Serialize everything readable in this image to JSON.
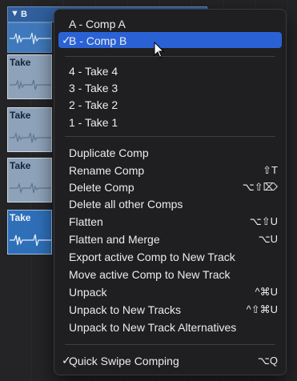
{
  "background": {
    "folder_label": "B",
    "take_labels": [
      "Take",
      "Take",
      "Take",
      "Take"
    ]
  },
  "menu": {
    "comps": [
      {
        "label": "A - Comp A",
        "checked": false,
        "selected": false
      },
      {
        "label": "B - Comp B",
        "checked": true,
        "selected": true
      }
    ],
    "takes": [
      {
        "label": "4 - Take 4"
      },
      {
        "label": "3 - Take 3"
      },
      {
        "label": "2 - Take 2"
      },
      {
        "label": "1 - Take 1"
      }
    ],
    "actions": [
      {
        "label": "Duplicate Comp",
        "shortcut": ""
      },
      {
        "label": "Rename Comp",
        "shortcut": "⇧T"
      },
      {
        "label": "Delete Comp",
        "shortcut": "⌥⇧⌦"
      },
      {
        "label": "Delete all other Comps",
        "shortcut": ""
      },
      {
        "label": "Flatten",
        "shortcut": "⌥⇧U"
      },
      {
        "label": "Flatten and Merge",
        "shortcut": "⌥U"
      },
      {
        "label": "Export active Comp to New Track",
        "shortcut": ""
      },
      {
        "label": "Move active Comp to New Track",
        "shortcut": ""
      },
      {
        "label": "Unpack",
        "shortcut": "^⌘U"
      },
      {
        "label": "Unpack to New Tracks",
        "shortcut": "^⇧⌘U"
      },
      {
        "label": "Unpack to New Track Alternatives",
        "shortcut": ""
      }
    ],
    "quick_swipe": {
      "label": "Quick Swipe Comping",
      "shortcut": "⌥Q",
      "checked": true
    },
    "check_glyph": "✓"
  },
  "colors": {
    "selection": "#2a62d6",
    "menu_bg": "#1f1f21",
    "take_region": "#8ea3b9",
    "active_take": "#2f6fb8"
  }
}
